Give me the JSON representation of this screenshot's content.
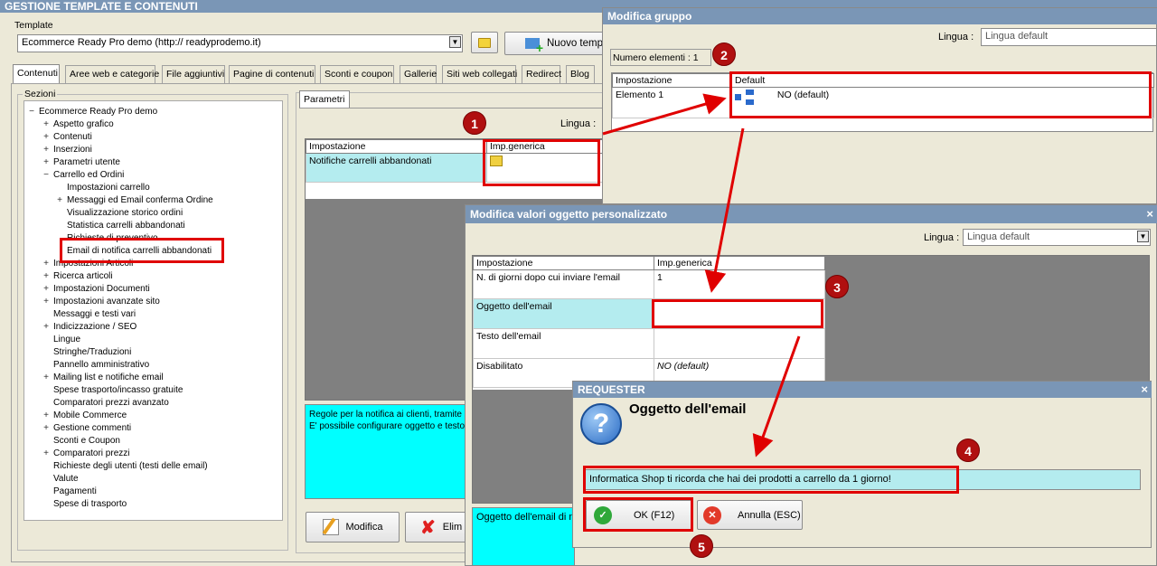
{
  "main": {
    "title": "GESTIONE TEMPLATE E CONTENUTI",
    "template_label": "Template",
    "template_value": "Ecommerce Ready Pro demo       (http://          readyprodemo.it)",
    "new_button": "Nuovo temp",
    "tabs": [
      "Contenuti",
      "Aree web e categorie",
      "File aggiuntivi",
      "Pagine di contenuti",
      "Sconti e coupon",
      "Gallerie",
      "Siti web collegati",
      "Redirect",
      "Blog"
    ],
    "sections_label": "Sezioni",
    "tree": [
      {
        "label": "Ecommerce Ready Pro demo",
        "exp": "−",
        "level": 0
      },
      {
        "label": "Aspetto grafico",
        "exp": "+",
        "level": 1
      },
      {
        "label": "Contenuti",
        "exp": "+",
        "level": 1
      },
      {
        "label": "Inserzioni",
        "exp": "+",
        "level": 1
      },
      {
        "label": "Parametri utente",
        "exp": "+",
        "level": 1
      },
      {
        "label": "Carrello ed Ordini",
        "exp": "−",
        "level": 1
      },
      {
        "label": "Impostazioni carrello",
        "exp": "",
        "level": 2
      },
      {
        "label": "Messaggi ed Email conferma Ordine",
        "exp": "+",
        "level": 2
      },
      {
        "label": "Visualizzazione storico ordini",
        "exp": "",
        "level": 2
      },
      {
        "label": "Statistica carrelli abbandonati",
        "exp": "",
        "level": 2
      },
      {
        "label": "Richieste di preventivo",
        "exp": "",
        "level": 2
      },
      {
        "label": "Email di notifica carrelli abbandonati",
        "exp": "",
        "level": 2
      },
      {
        "label": "Impostazioni Articoli",
        "exp": "+",
        "level": 1
      },
      {
        "label": "Ricerca articoli",
        "exp": "+",
        "level": 1
      },
      {
        "label": "Impostazioni Documenti",
        "exp": "+",
        "level": 1
      },
      {
        "label": "Impostazioni avanzate sito",
        "exp": "+",
        "level": 1
      },
      {
        "label": "Messaggi e testi vari",
        "exp": "",
        "level": 1
      },
      {
        "label": "Indicizzazione / SEO",
        "exp": "+",
        "level": 1
      },
      {
        "label": "Lingue",
        "exp": "",
        "level": 1
      },
      {
        "label": "Stringhe/Traduzioni",
        "exp": "",
        "level": 1
      },
      {
        "label": "Pannello amministrativo",
        "exp": "",
        "level": 1
      },
      {
        "label": "Mailing list e notifiche email",
        "exp": "+",
        "level": 1
      },
      {
        "label": "Spese trasporto/incasso gratuite",
        "exp": "",
        "level": 1
      },
      {
        "label": "Comparatori prezzi avanzato",
        "exp": "",
        "level": 1
      },
      {
        "label": "Mobile Commerce",
        "exp": "+",
        "level": 1
      },
      {
        "label": "Gestione commenti",
        "exp": "+",
        "level": 1
      },
      {
        "label": "Sconti e Coupon",
        "exp": "",
        "level": 1
      },
      {
        "label": "Comparatori prezzi",
        "exp": "+",
        "level": 1
      },
      {
        "label": "Richieste degli utenti (testi delle email)",
        "exp": "",
        "level": 1
      },
      {
        "label": "Valute",
        "exp": "",
        "level": 1
      },
      {
        "label": "Pagamenti",
        "exp": "",
        "level": 1
      },
      {
        "label": "Spese di trasporto",
        "exp": "",
        "level": 1
      }
    ],
    "params_tab": "Parametri",
    "lingua_label": "Lingua :",
    "grid_header": [
      "Impostazione",
      "Imp.generica"
    ],
    "grid_row": "Notifiche carrelli abbandonati",
    "description": "Regole per la notifica ai clienti, tramite e\nE' possibile configurare oggetto e testo",
    "modifica_button": "Modifica",
    "elimina_button": "Elim"
  },
  "group": {
    "title": "Modifica gruppo",
    "lingua_label": "Lingua :",
    "lingua_value": "Lingua default",
    "count_label": "Numero elementi : 1",
    "headers": [
      "Impostazione",
      "Default"
    ],
    "row_label": "Elemento 1",
    "row_value": "NO (default)"
  },
  "custom": {
    "title": "Modifica valori oggetto personalizzato",
    "lingua_label": "Lingua :",
    "lingua_value": "Lingua default",
    "headers": [
      "Impostazione",
      "Imp.generica"
    ],
    "rows": [
      {
        "label": "N. di giorni dopo cui inviare l'email",
        "value": "1"
      },
      {
        "label": "Oggetto dell'email",
        "value": ""
      },
      {
        "label": "Testo dell'email",
        "value": ""
      },
      {
        "label": "Disabilitato",
        "value": "NO (default)"
      }
    ],
    "bottom_text": "Oggetto dell'email di n"
  },
  "requester": {
    "title": "REQUESTER",
    "heading": "Oggetto dell'email",
    "input_value": "Informatica Shop ti ricorda che hai dei prodotti a carrello da 1 giorno!",
    "ok_label": "OK (F12)",
    "cancel_label": "Annulla (ESC)"
  },
  "badges": [
    "1",
    "2",
    "3",
    "4",
    "5"
  ],
  "colors": {
    "highlight": "#e00000",
    "cyan": "#00ffff",
    "row_cyan": "#b4ecef",
    "titlebar": "#7a96b6"
  }
}
